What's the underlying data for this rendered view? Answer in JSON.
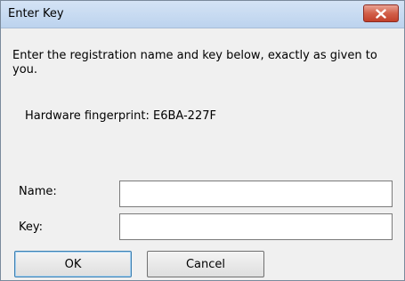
{
  "window": {
    "title": "Enter Key"
  },
  "dialog": {
    "instructions": "Enter the registration name and key below, exactly as given to you.",
    "fingerprint": "Hardware fingerprint: E6BA-227F",
    "name_label": "Name:",
    "name_value": "",
    "key_label": "Key:",
    "key_value": "",
    "ok_label": "OK",
    "cancel_label": "Cancel"
  },
  "icons": {
    "close": "close-icon"
  },
  "colors": {
    "titlebar": "#c6d9f1",
    "close_button": "#c7442e",
    "dialog_bg": "#f0f0f0"
  }
}
